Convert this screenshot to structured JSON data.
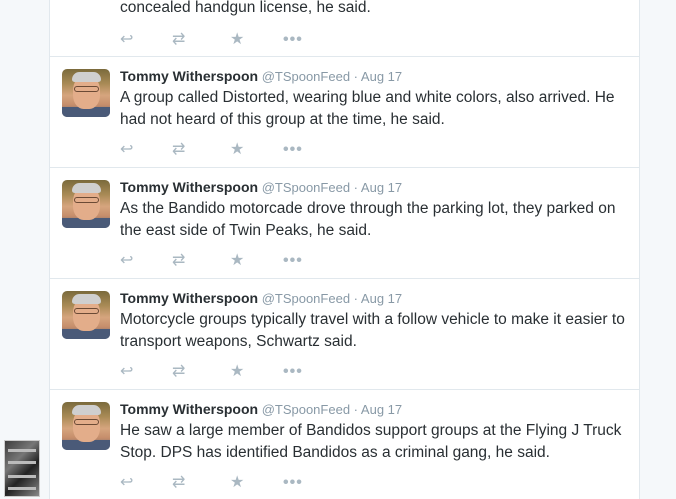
{
  "tweets": [
    {
      "fullname": "",
      "username": "",
      "time": "",
      "text": "concealed handgun license, he said."
    },
    {
      "fullname": "Tommy Witherspoon",
      "username": "@TSpoonFeed",
      "time": "Aug 17",
      "text": "A group called Distorted, wearing blue and white colors, also arrived. He had not heard of this group at the time, he said."
    },
    {
      "fullname": "Tommy Witherspoon",
      "username": "@TSpoonFeed",
      "time": "Aug 17",
      "text": "As the Bandido motorcade drove through the parking lot, they parked on the east side of Twin Peaks, he said."
    },
    {
      "fullname": "Tommy Witherspoon",
      "username": "@TSpoonFeed",
      "time": "Aug 17",
      "text": "Motorcycle groups typically travel with a follow vehicle to make it easier to transport weapons, Schwartz said."
    },
    {
      "fullname": "Tommy Witherspoon",
      "username": "@TSpoonFeed",
      "time": "Aug 17",
      "text": "He saw a large member of Bandidos support groups at the Flying J Truck Stop. DPS has identified Bandidos as a criminal gang, he said."
    }
  ],
  "separator": "·",
  "icons": {
    "reply": "reply-icon",
    "retweet": "retweet-icon",
    "favorite": "star-icon",
    "more": "more-icon"
  },
  "glyphs": {
    "reply": "↩",
    "retweet": "⇄",
    "favorite": "★",
    "more": "•••"
  }
}
